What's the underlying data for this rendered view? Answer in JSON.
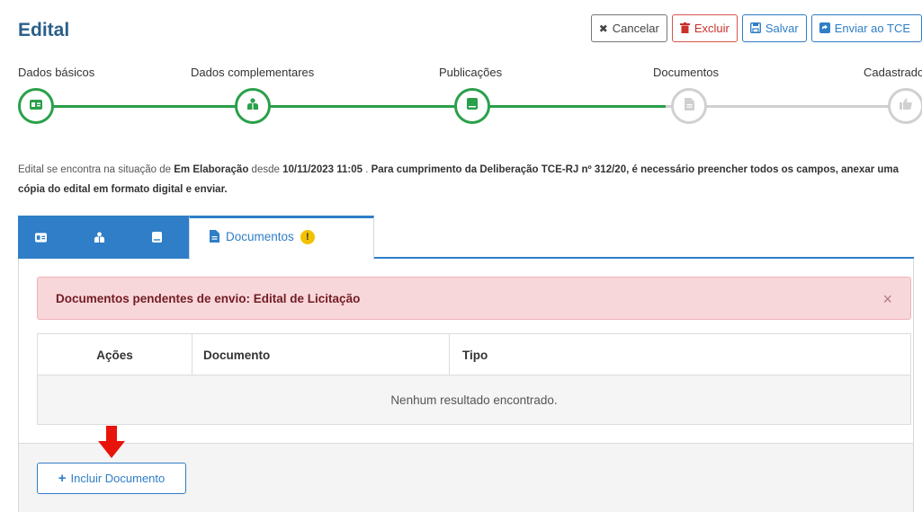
{
  "page": {
    "title": "Edital"
  },
  "toolbar": {
    "cancel_label": "Cancelar",
    "delete_label": "Excluir",
    "save_label": "Salvar",
    "send_label": "Enviar ao TCE"
  },
  "steps": [
    {
      "label": "Dados básicos",
      "state": "done",
      "icon": "id-card-icon"
    },
    {
      "label": "Dados complementares",
      "state": "done",
      "icon": "people-icon"
    },
    {
      "label": "Publicações",
      "state": "done",
      "icon": "book-icon"
    },
    {
      "label": "Documentos",
      "state": "todo",
      "icon": "file-icon"
    },
    {
      "label": "Cadastrado",
      "state": "todo",
      "icon": "thumbs-up-icon"
    }
  ],
  "info": {
    "prefix": "Edital se encontra na situação de ",
    "status": "Em Elaboração",
    "since_label": " desde ",
    "since_date": "10/11/2023 11:05",
    "sep": " . ",
    "note": "Para cumprimento da Deliberação TCE-RJ nº 312/20, é necessário preencher todos os campos, anexar uma cópia do edital em formato digital e enviar."
  },
  "tabs": {
    "active_label": "Documentos",
    "warning_mark": "!"
  },
  "alert": {
    "message": "Documentos pendentes de envio: Edital de Licitação",
    "close": "×"
  },
  "table": {
    "columns": [
      "Ações",
      "Documento",
      "Tipo"
    ],
    "empty_message": "Nenhum resultado encontrado."
  },
  "footer": {
    "add_label": "Incluir Documento"
  },
  "colors": {
    "primary": "#2f7ec7",
    "success": "#2aa04a",
    "danger": "#c9302c",
    "pending": "#d0d0d0",
    "annotation_arrow": "#e8140c"
  }
}
